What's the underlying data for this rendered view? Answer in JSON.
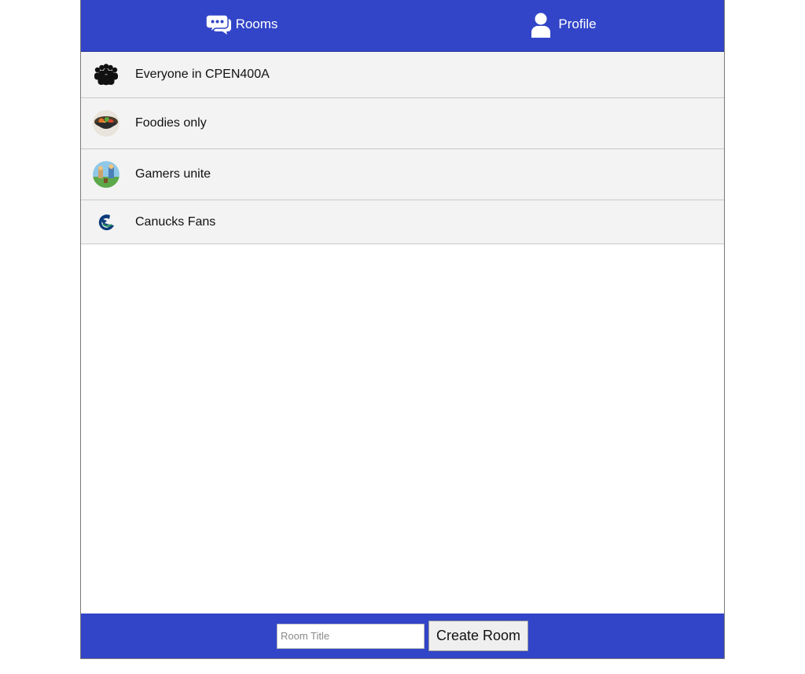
{
  "nav": {
    "rooms_label": "Rooms",
    "rooms_icon": "chat-bubbles-icon",
    "profile_label": "Profile",
    "profile_icon": "user-icon"
  },
  "rooms": [
    {
      "name": "Everyone in CPEN400A",
      "icon": "group-people-icon"
    },
    {
      "name": "Foodies only",
      "icon": "food-bowl-icon"
    },
    {
      "name": "Gamers unite",
      "icon": "game-scene-icon"
    },
    {
      "name": "Canucks Fans",
      "icon": "canucks-logo-icon"
    }
  ],
  "footer": {
    "room_title_placeholder": "Room Title",
    "room_title_value": "",
    "create_label": "Create Room"
  },
  "colors": {
    "primary": "#3245c8",
    "row_bg": "#f3f3f3",
    "row_border": "#c8c8c8"
  }
}
